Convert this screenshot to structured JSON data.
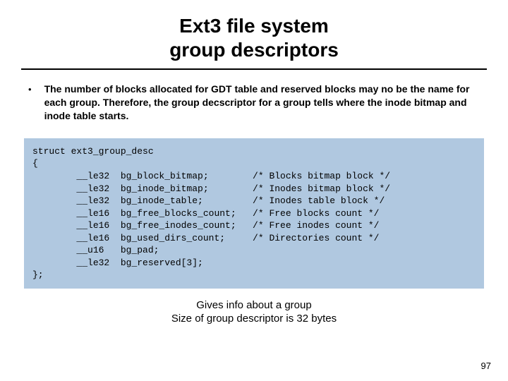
{
  "title": {
    "line1": "Ext3 file system",
    "line2": "group descriptors"
  },
  "bullet_glyph": "•",
  "body_paragraph": "The number of blocks allocated for GDT table and reserved blocks may no be the name for each group. Therefore, the group decscriptor for a group tells where the inode bitmap and inode table starts.",
  "code_text": "struct ext3_group_desc\n{\n        __le32  bg_block_bitmap;        /* Blocks bitmap block */\n        __le32  bg_inode_bitmap;        /* Inodes bitmap block */\n        __le32  bg_inode_table;         /* Inodes table block */\n        __le16  bg_free_blocks_count;   /* Free blocks count */\n        __le16  bg_free_inodes_count;   /* Free inodes count */\n        __le16  bg_used_dirs_count;     /* Directories count */\n        __u16   bg_pad;\n        __le32  bg_reserved[3];\n};",
  "caption": {
    "line1": "Gives info about a group",
    "line2": "Size of group descriptor is 32 bytes"
  },
  "page_number": "97"
}
